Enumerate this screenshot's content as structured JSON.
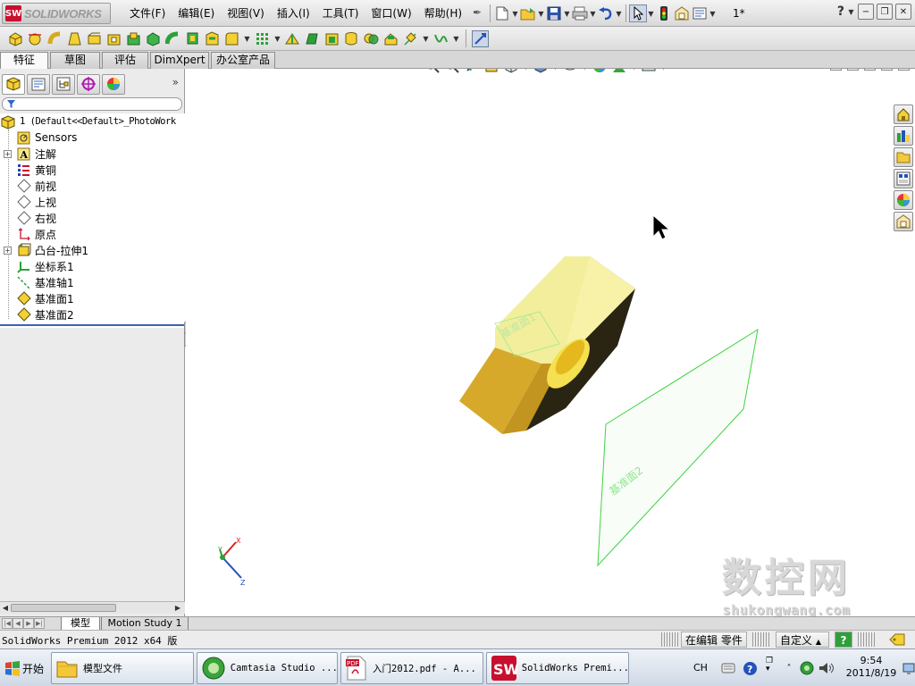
{
  "app": {
    "logo_mark": "SW",
    "logo_text": "SOLIDWORKS"
  },
  "menubar": {
    "items": [
      "文件(F)",
      "编辑(E)",
      "视图(V)",
      "插入(I)",
      "工具(T)",
      "窗口(W)",
      "帮助(H)"
    ],
    "rebuild_count": "1*",
    "help_label": "?"
  },
  "command_tabs": [
    "特征",
    "草图",
    "评估",
    "DimXpert",
    "办公室产品"
  ],
  "feature_tree": {
    "root": "1  (Default<<Default>_PhotoWork",
    "items": [
      {
        "label": "Sensors",
        "icon": "sensors-icon",
        "expandable": false
      },
      {
        "label": "注解",
        "icon": "annotations-icon",
        "expandable": true
      },
      {
        "label": "黄铜",
        "icon": "material-icon",
        "expandable": false
      },
      {
        "label": "前视",
        "icon": "plane-icon",
        "expandable": false
      },
      {
        "label": "上视",
        "icon": "plane-icon",
        "expandable": false
      },
      {
        "label": "右视",
        "icon": "plane-icon",
        "expandable": false
      },
      {
        "label": "原点",
        "icon": "origin-icon",
        "expandable": false
      },
      {
        "label": "凸台-拉伸1",
        "icon": "extrude-icon",
        "expandable": true
      },
      {
        "label": "坐标系1",
        "icon": "coordinate-system-icon",
        "expandable": false
      },
      {
        "label": "基准轴1",
        "icon": "axis-icon",
        "expandable": false
      },
      {
        "label": "基准面1",
        "icon": "reference-plane-icon",
        "expandable": false
      },
      {
        "label": "基准面2",
        "icon": "reference-plane-icon",
        "expandable": false
      }
    ]
  },
  "viewport": {
    "plane1_label": "基准面1",
    "plane2_label": "基准面2",
    "triad": {
      "x": "X",
      "y": "Y",
      "z": "Z"
    }
  },
  "watermark": {
    "title": "数控网",
    "url": "shukongwang.com"
  },
  "bottom_tabs": [
    "模型",
    "Motion Study 1"
  ],
  "status": {
    "product": "SolidWorks Premium 2012 x64 版",
    "editing": "在编辑 零件",
    "custom": "自定义",
    "custom_arrow": "▲",
    "help": "?"
  },
  "taskbar": {
    "start": "开始",
    "tasks": [
      {
        "label": "模型文件",
        "icon": "folder-icon"
      },
      {
        "label": "Camtasia Studio ...",
        "icon": "camtasia-icon"
      },
      {
        "label": "入门2012.pdf - A...",
        "icon": "pdf-icon"
      },
      {
        "label": "SolidWorks Premi...",
        "icon": "solidworks-icon"
      }
    ],
    "ime": "CH",
    "time": "9:54",
    "date": "2011/8/19"
  },
  "colors": {
    "part_top": "#f2ee9c",
    "part_side": "#d6a92a",
    "part_dark": "#2a2412",
    "plane": "#33cc33",
    "accent": "#3a63b5"
  }
}
